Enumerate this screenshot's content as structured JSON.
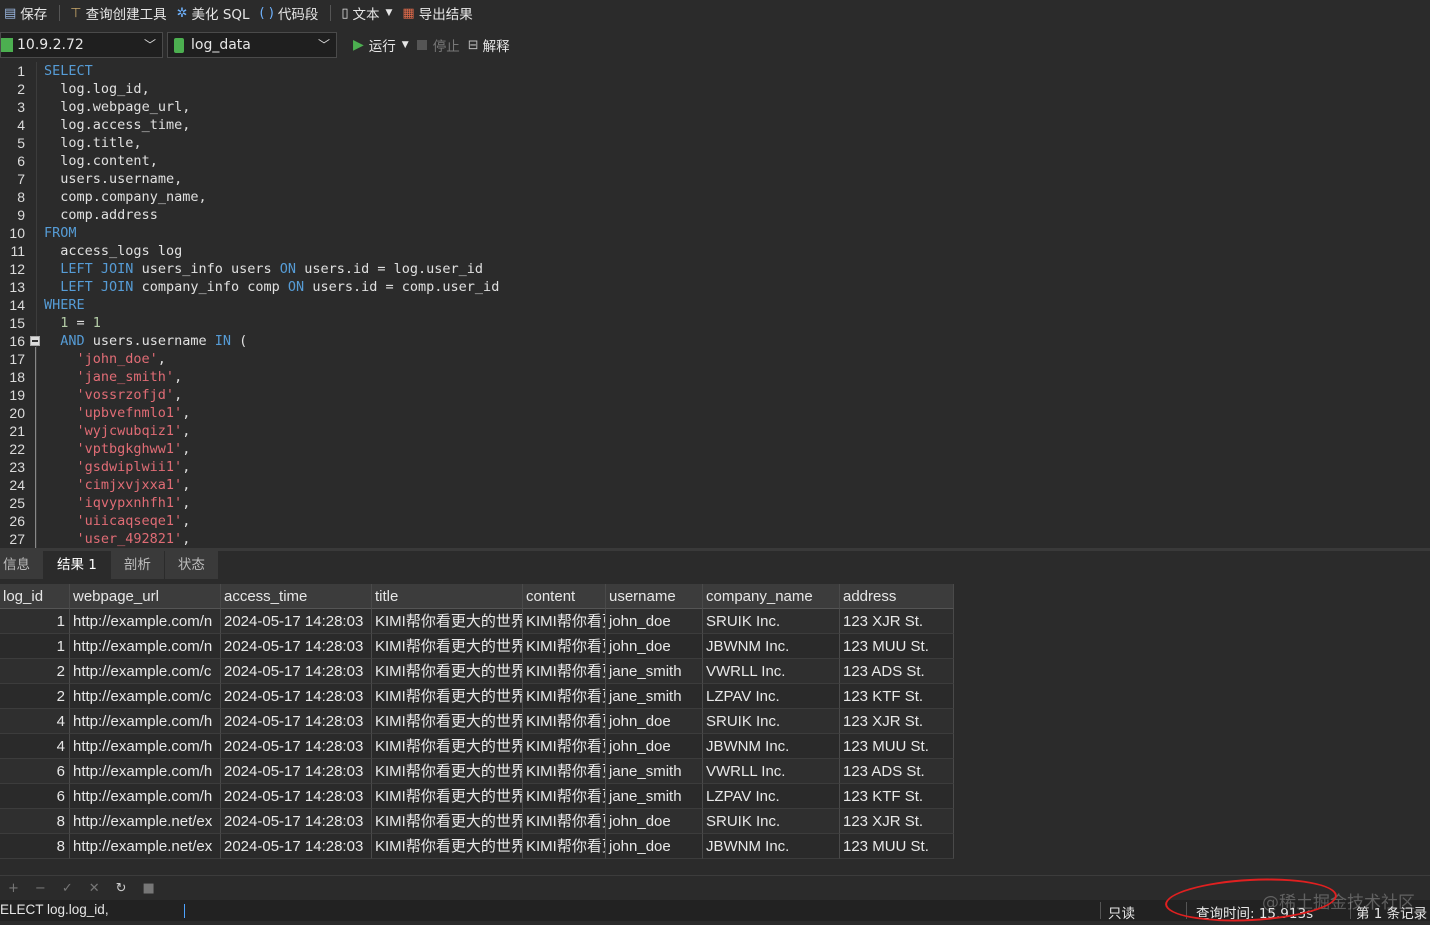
{
  "toolbar": {
    "save": "保存",
    "query_builder": "查询创建工具",
    "beautify_sql": "美化 SQL",
    "snippet": "代码段",
    "text": "文本",
    "export": "导出结果"
  },
  "connection": {
    "host": "10.9.2.72",
    "database": "log_data"
  },
  "run_bar": {
    "run": "运行",
    "stop": "停止",
    "explain": "解释"
  },
  "code_lines": [
    {
      "n": "1",
      "text": "SELECT"
    },
    {
      "n": "2",
      "text": "  log.log_id,"
    },
    {
      "n": "3",
      "text": "  log.webpage_url,"
    },
    {
      "n": "4",
      "text": "  log.access_time,"
    },
    {
      "n": "5",
      "text": "  log.title,"
    },
    {
      "n": "6",
      "text": "  log.content,"
    },
    {
      "n": "7",
      "text": "  users.username,"
    },
    {
      "n": "8",
      "text": "  comp.company_name,"
    },
    {
      "n": "9",
      "text": "  comp.address"
    },
    {
      "n": "10",
      "text": "FROM"
    },
    {
      "n": "11",
      "text": "  access_logs log"
    },
    {
      "n": "12",
      "text": "  LEFT JOIN users_info users ON users.id = log.user_id"
    },
    {
      "n": "13",
      "text": "  LEFT JOIN company_info comp ON users.id = comp.user_id"
    },
    {
      "n": "14",
      "text": "WHERE"
    },
    {
      "n": "15",
      "text": "  1 = 1"
    },
    {
      "n": "16",
      "text": "  AND users.username IN ("
    },
    {
      "n": "17",
      "text": "    'john_doe',"
    },
    {
      "n": "18",
      "text": "    'jane_smith',"
    },
    {
      "n": "19",
      "text": "    'vossrzofjd',"
    },
    {
      "n": "20",
      "text": "    'upbvefnmlo1',"
    },
    {
      "n": "21",
      "text": "    'wyjcwubqiz1',"
    },
    {
      "n": "22",
      "text": "    'vptbgkghww1',"
    },
    {
      "n": "23",
      "text": "    'gsdwiplwii1',"
    },
    {
      "n": "24",
      "text": "    'cimjxvjxxa1',"
    },
    {
      "n": "25",
      "text": "    'iqvypxnhfh1',"
    },
    {
      "n": "26",
      "text": "    'uiicaqseqe1',"
    },
    {
      "n": "27",
      "text": "    'user_492821',"
    }
  ],
  "tabs": [
    "信息",
    "结果 1",
    "剖析",
    "状态"
  ],
  "active_tab": 1,
  "grid": {
    "columns": [
      "log_id",
      "webpage_url",
      "access_time",
      "title",
      "content",
      "username",
      "company_name",
      "address"
    ],
    "rows": [
      [
        "1",
        "http://example.com/n",
        "2024-05-17 14:28:03",
        "KIMI帮你看更大的世界",
        "KIMI帮你看更",
        "john_doe",
        "SRUIK Inc.",
        "123 XJR St."
      ],
      [
        "1",
        "http://example.com/n",
        "2024-05-17 14:28:03",
        "KIMI帮你看更大的世界",
        "KIMI帮你看更",
        "john_doe",
        "JBWNM Inc.",
        "123 MUU St."
      ],
      [
        "2",
        "http://example.com/c",
        "2024-05-17 14:28:03",
        "KIMI帮你看更大的世界",
        "KIMI帮你看更",
        "jane_smith",
        "VWRLL Inc.",
        "123 ADS St."
      ],
      [
        "2",
        "http://example.com/c",
        "2024-05-17 14:28:03",
        "KIMI帮你看更大的世界",
        "KIMI帮你看更",
        "jane_smith",
        "LZPAV Inc.",
        "123 KTF St."
      ],
      [
        "4",
        "http://example.com/h",
        "2024-05-17 14:28:03",
        "KIMI帮你看更大的世界",
        "KIMI帮你看更",
        "john_doe",
        "SRUIK Inc.",
        "123 XJR St."
      ],
      [
        "4",
        "http://example.com/h",
        "2024-05-17 14:28:03",
        "KIMI帮你看更大的世界",
        "KIMI帮你看更",
        "john_doe",
        "JBWNM Inc.",
        "123 MUU St."
      ],
      [
        "6",
        "http://example.com/h",
        "2024-05-17 14:28:03",
        "KIMI帮你看更大的世界",
        "KIMI帮你看更",
        "jane_smith",
        "VWRLL Inc.",
        "123 ADS St."
      ],
      [
        "6",
        "http://example.com/h",
        "2024-05-17 14:28:03",
        "KIMI帮你看更大的世界",
        "KIMI帮你看更",
        "jane_smith",
        "LZPAV Inc.",
        "123 KTF St."
      ],
      [
        "8",
        "http://example.net/ex",
        "2024-05-17 14:28:03",
        "KIMI帮你看更大的世界",
        "KIMI帮你看更",
        "john_doe",
        "SRUIK Inc.",
        "123 XJR St."
      ],
      [
        "8",
        "http://example.net/ex",
        "2024-05-17 14:28:03",
        "KIMI帮你看更大的世界",
        "KIMI帮你看更",
        "john_doe",
        "JBWNM Inc.",
        "123 MUU St."
      ]
    ]
  },
  "status": {
    "sql_preview": "ELECT     log.log_id,",
    "readonly": "只读",
    "query_time": "查询时间: 15.913s",
    "record": "第 1 条记录",
    "watermark": "@稀土掘金技术社区"
  },
  "colors": {
    "keyword": "#569cd6",
    "string": "#e06c75",
    "run_icon": "#4caf50",
    "highlight": "#e02020"
  }
}
